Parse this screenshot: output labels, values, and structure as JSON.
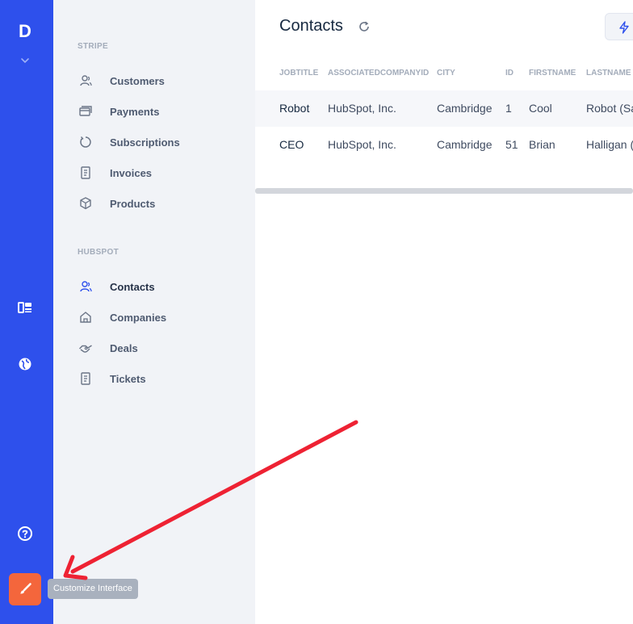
{
  "app": {
    "logo_letter": "D",
    "accent": "#2e50ec",
    "customize_color": "#f4663c"
  },
  "rail": {
    "items": [
      {
        "icon": "dashboard-icon"
      },
      {
        "icon": "globe-icon"
      },
      {
        "icon": "help-icon"
      },
      {
        "icon": "paintbrush-icon"
      }
    ]
  },
  "tooltip": {
    "text": "Customize Interface"
  },
  "sidebar": {
    "stripe_label": "STRIPE",
    "stripe_items": [
      {
        "label": "Customers",
        "icon": "users-icon"
      },
      {
        "label": "Payments",
        "icon": "credit-card-icon"
      },
      {
        "label": "Subscriptions",
        "icon": "refresh-icon"
      },
      {
        "label": "Invoices",
        "icon": "receipt-icon"
      },
      {
        "label": "Products",
        "icon": "box-icon"
      }
    ],
    "hubspot_label": "HUBSPOT",
    "hubspot_items": [
      {
        "label": "Contacts",
        "icon": "users-icon",
        "active": true
      },
      {
        "label": "Companies",
        "icon": "home-icon"
      },
      {
        "label": "Deals",
        "icon": "handshake-icon"
      },
      {
        "label": "Tickets",
        "icon": "receipt-icon"
      }
    ]
  },
  "main": {
    "title": "Contacts",
    "columns": [
      "JOBTITLE",
      "ASSOCIATEDCOMPANYID",
      "CITY",
      "ID",
      "FIRSTNAME",
      "LASTNAME"
    ],
    "rows": [
      [
        "Robot",
        "HubSpot, Inc.",
        "Cambridge",
        "1",
        "Cool",
        "Robot (Sa"
      ],
      [
        "CEO",
        "HubSpot, Inc.",
        "Cambridge",
        "51",
        "Brian",
        "Halligan ("
      ]
    ]
  }
}
